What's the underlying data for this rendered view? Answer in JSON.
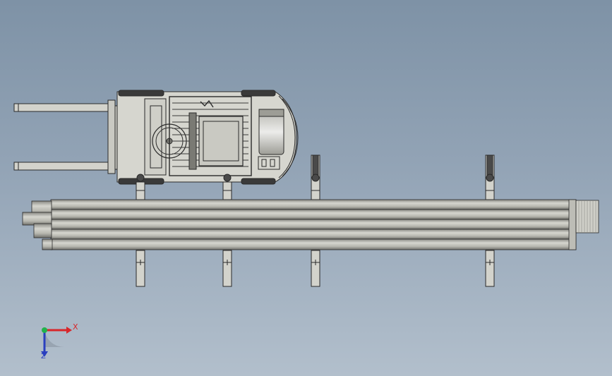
{
  "viewport": {
    "background_top": "#7e92a6",
    "background_bottom": "#b2bfcc"
  },
  "model": {
    "part_fill": "#d3d3cc",
    "part_stroke": "#2a2a2a",
    "pipe_light": "#c9c9c2",
    "pipe_dark": "#6f6f6a",
    "support_count": 4,
    "pipe_count": 5
  },
  "triad": {
    "x_label": "X",
    "z_label": "Z",
    "x_color": "#d8262a",
    "y_color": "#22b24c",
    "z_color": "#2a3fbf"
  }
}
